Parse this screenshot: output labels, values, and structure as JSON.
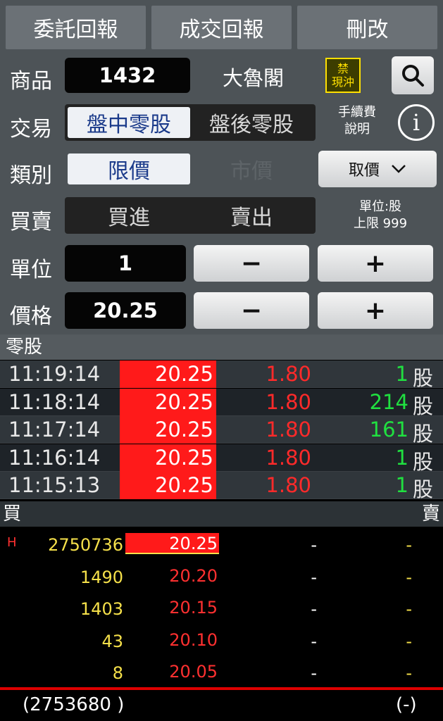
{
  "tabs": [
    "委託回報",
    "成交回報",
    "刪改"
  ],
  "form": {
    "product_label": "商品",
    "product_code": "1432",
    "product_name": "大魯閣",
    "ban_badge": "禁\n現沖",
    "trade_label": "交易",
    "trade_options": [
      "盤中零股",
      "盤後零股"
    ],
    "fee_info": "手續費\n說明",
    "type_label": "類別",
    "type_options": [
      "限價",
      "市價"
    ],
    "price_select": "取價",
    "side_label": "買賣",
    "side_options": [
      "買進",
      "賣出"
    ],
    "unit_info": "單位:股\n上限 999",
    "qty_label": "單位",
    "qty_value": "1",
    "price_label": "價格",
    "price_value": "20.25",
    "minus": "−",
    "plus": "+"
  },
  "trades": {
    "title": "零股",
    "unit": "股",
    "rows": [
      {
        "time": "11:19:14",
        "price": "20.25",
        "change": "1.80",
        "volume": "1"
      },
      {
        "time": "11:18:14",
        "price": "20.25",
        "change": "1.80",
        "volume": "214"
      },
      {
        "time": "11:17:14",
        "price": "20.25",
        "change": "1.80",
        "volume": "161"
      },
      {
        "time": "11:16:14",
        "price": "20.25",
        "change": "1.80",
        "volume": "1"
      },
      {
        "time": "11:15:13",
        "price": "20.25",
        "change": "1.80",
        "volume": "1"
      }
    ]
  },
  "book": {
    "buy_label": "買",
    "sell_label": "賣",
    "rows": [
      {
        "flag": "H",
        "bid_qty": "2750736",
        "bid_price": "20.25",
        "ask_price": "-",
        "ask_qty": "-"
      },
      {
        "flag": "",
        "bid_qty": "1490",
        "bid_price": "20.20",
        "ask_price": "-",
        "ask_qty": "-"
      },
      {
        "flag": "",
        "bid_qty": "1403",
        "bid_price": "20.15",
        "ask_price": "-",
        "ask_qty": "-"
      },
      {
        "flag": "",
        "bid_qty": "43",
        "bid_price": "20.10",
        "ask_price": "-",
        "ask_qty": "-"
      },
      {
        "flag": "",
        "bid_qty": "8",
        "bid_price": "20.05",
        "ask_price": "-",
        "ask_qty": "-"
      }
    ],
    "total_bid": "(2753680 )",
    "total_ask": "(-)"
  },
  "colors": {
    "up": "#ff1a1a",
    "volume": "#20e040",
    "qty": "#f5e04a",
    "active_text": "#1a3a8a"
  }
}
